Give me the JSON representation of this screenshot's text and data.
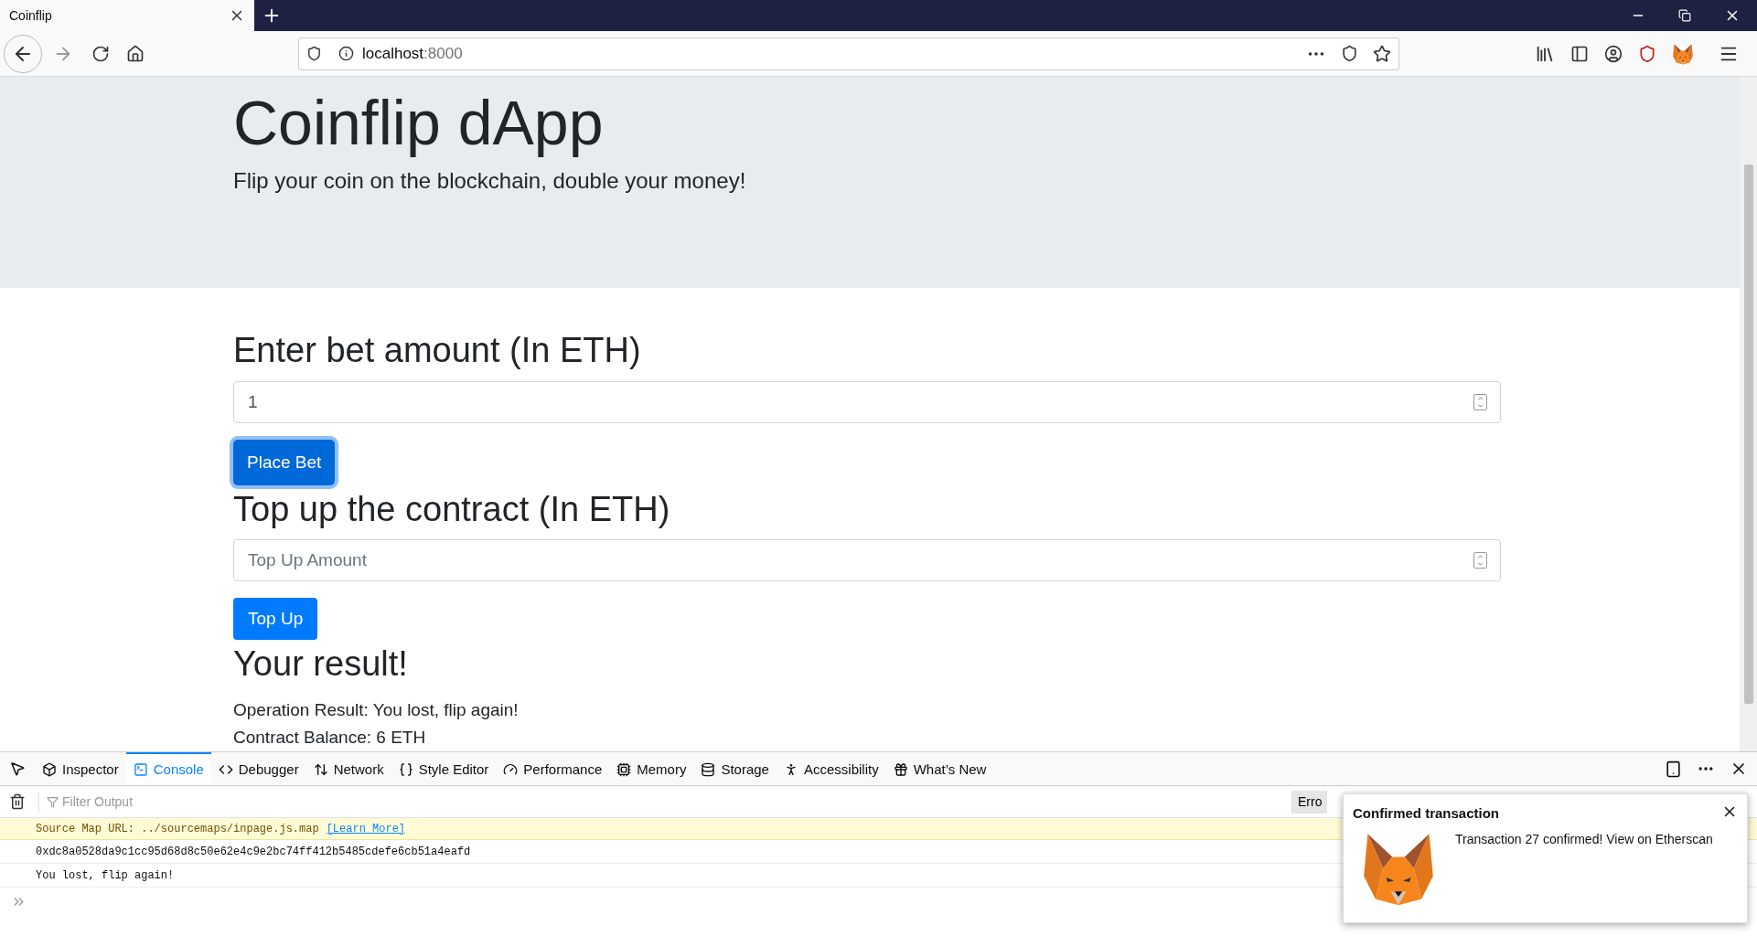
{
  "browser": {
    "tab_title": "Coinflip",
    "url_host": "localhost",
    "url_port": ":8000"
  },
  "jumbotron": {
    "title": "Coinflip dApp",
    "lead": "Flip your coin on the blockchain, double your money!"
  },
  "forms": [
    {
      "heading": "Enter bet amount (In ETH)",
      "value": "1",
      "button": "Place Bet",
      "focused": true
    },
    {
      "heading": "Top up the contract (In ETH)",
      "placeholder": "Top Up Amount",
      "button": "Top Up",
      "focused": false
    }
  ],
  "result": {
    "heading": "Your result!",
    "lines": [
      "Operation Result: You lost, flip again!",
      "Contract Balance: 6 ETH"
    ]
  },
  "devtools": {
    "tabs": [
      {
        "label": "Inspector",
        "selected": false
      },
      {
        "label": "Console",
        "selected": true
      },
      {
        "label": "Debugger",
        "selected": false
      },
      {
        "label": "Network",
        "selected": false
      },
      {
        "label": "Style Editor",
        "selected": false
      },
      {
        "label": "Performance",
        "selected": false
      },
      {
        "label": "Memory",
        "selected": false
      },
      {
        "label": "Storage",
        "selected": false
      },
      {
        "label": "Accessibility",
        "selected": false
      },
      {
        "label": "What’s New",
        "selected": false
      }
    ],
    "filter_placeholder": "Filter Output",
    "filter_button": "Erro",
    "rows": [
      {
        "kind": "warning",
        "text": "Source Map URL: ../sourcemaps/inpage.js.map",
        "link": "[Learn More]"
      },
      {
        "kind": "log",
        "text": "0xdc8a0528da9c1cc95d68d8c50e62e4c9e2bc74ff412b5485cdefe6cb51a4eafd"
      },
      {
        "kind": "log",
        "text": "You lost, flip again!"
      }
    ]
  },
  "notification": {
    "title": "Confirmed transaction",
    "message": "Transaction 27 confirmed! View on Etherscan"
  }
}
